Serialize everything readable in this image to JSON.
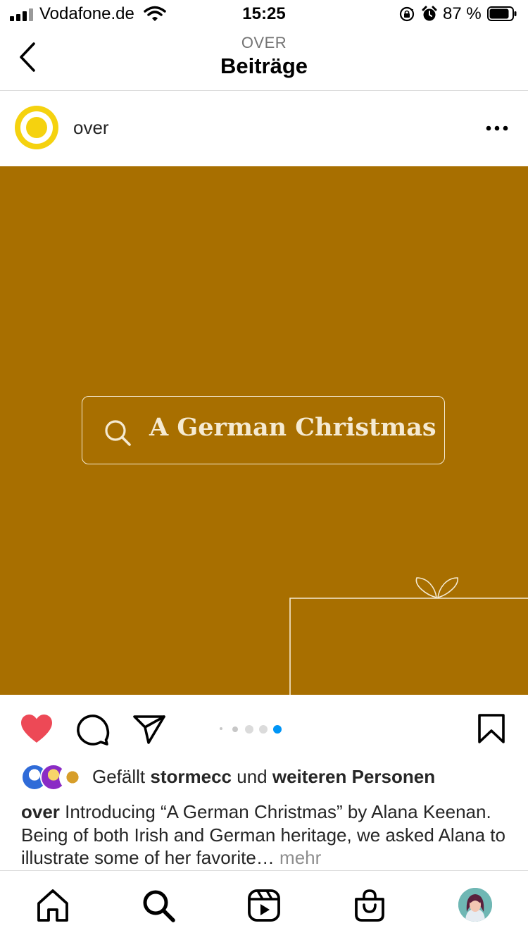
{
  "status_bar": {
    "carrier": "Vodafone.de",
    "time": "15:25",
    "battery_percent": "87 %",
    "battery_level": 0.87,
    "icons": [
      "signal-icon",
      "wifi-icon",
      "rotation-lock-icon",
      "alarm-icon",
      "battery-icon"
    ]
  },
  "header": {
    "subtitle": "OVER",
    "title": "Beiträge",
    "back_icon": "chevron-left-icon"
  },
  "post": {
    "username": "over",
    "avatar_color": "#f5d20f",
    "more_icon": "ellipsis-icon",
    "image": {
      "background": "#a86f00",
      "search_text": "A German Christmas",
      "line_color": "#f5ead2"
    },
    "carousel": {
      "total": 5,
      "active_index": 4,
      "active_color": "#0095f6"
    },
    "like_color": "#ed4956",
    "likes": {
      "prefix": "Gefällt",
      "user": "stormecc",
      "conjunction": "und",
      "others": "weiteren Personen"
    },
    "caption": {
      "username": "over",
      "text": "Introducing “A German Christmas” by Alana Keenan. Being of both Irish and German heritage, we asked Alana to illustrate some of her favorite…",
      "more": "mehr"
    }
  },
  "tab_bar": {
    "items": [
      "home-icon",
      "search-icon",
      "reels-icon",
      "shop-icon",
      "profile-avatar"
    ]
  }
}
